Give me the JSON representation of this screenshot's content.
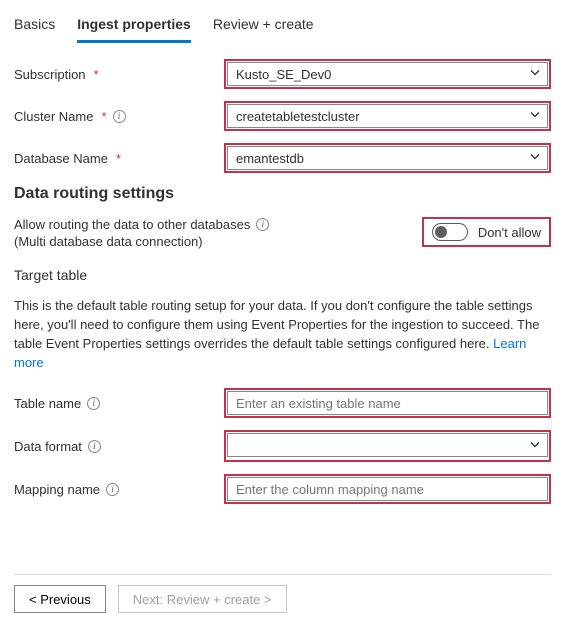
{
  "tabs": {
    "basics": "Basics",
    "ingest": "Ingest properties",
    "review": "Review + create"
  },
  "labels": {
    "subscription": "Subscription",
    "clusterName": "Cluster Name",
    "databaseName": "Database Name",
    "tableName": "Table name",
    "dataFormat": "Data format",
    "mappingName": "Mapping name"
  },
  "values": {
    "subscription": "Kusto_SE_Dev0",
    "clusterName": "createtabletestcluster",
    "databaseName": "emantestdb",
    "dataFormat": ""
  },
  "placeholders": {
    "tableName": "Enter an existing table name",
    "mappingName": "Enter the column mapping name"
  },
  "sections": {
    "routingTitle": "Data routing settings",
    "routingLine1": "Allow routing the data to other databases",
    "routingLine2": "(Multi database data connection)",
    "targetTable": "Target table",
    "description": "This is the default table routing setup for your data. If you don't configure the table settings here, you'll need to configure them using Event Properties for the ingestion to succeed. The table Event Properties settings overrides the default table settings configured here. ",
    "learnMore": "Learn more"
  },
  "toggle": {
    "label": "Don't allow"
  },
  "footer": {
    "previous": "<  Previous",
    "next": "Next: Review + create  >"
  },
  "icons": {
    "info": "i"
  }
}
